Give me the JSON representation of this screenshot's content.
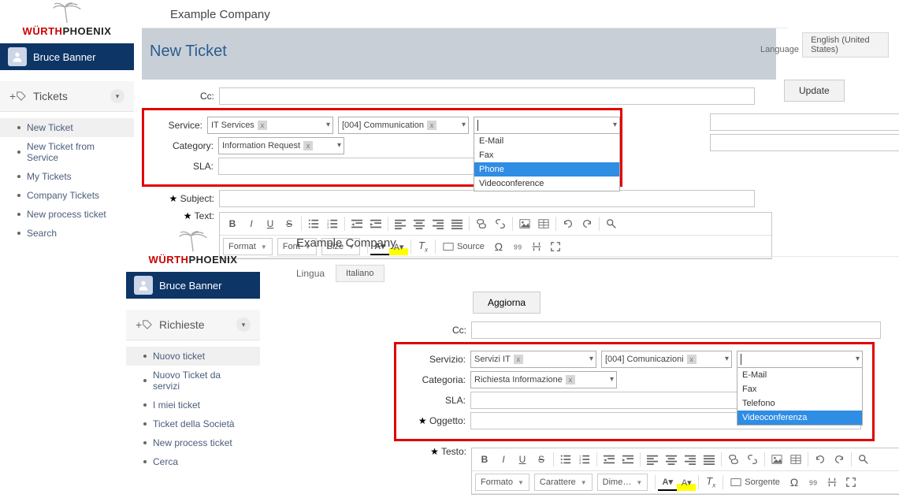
{
  "brand": {
    "part1": "WÜRTH",
    "part2": "PHOENIX"
  },
  "user": {
    "name": "Bruce Banner"
  },
  "en": {
    "company": "Example Company",
    "title": "New Ticket",
    "lang_label": "Language",
    "lang_value": "English (United States)",
    "update": "Update",
    "nav": {
      "section": "Tickets",
      "items": [
        "New Ticket",
        "New Ticket from Service",
        "My Tickets",
        "Company Tickets",
        "New process ticket",
        "Search"
      ]
    },
    "labels": {
      "cc": "Cc:",
      "service": "Service:",
      "category": "Category:",
      "sla": "SLA:",
      "subject": "Subject:",
      "text": "Text:"
    },
    "service_combo1": "IT Services",
    "service_combo2": "[004] Communication",
    "category_combo": "Information Request",
    "dropdown": {
      "options": [
        "E-Mail",
        "Fax",
        "Phone",
        "Videoconference"
      ],
      "selected_index": 2
    },
    "toolbar": {
      "format": "Format",
      "font": "Font",
      "size": "Size",
      "source": "Source"
    }
  },
  "it": {
    "company": "Example Company",
    "lang_label": "Lingua",
    "lang_value": "Italiano",
    "update": "Aggiorna",
    "nav": {
      "section": "Richieste",
      "items": [
        "Nuovo ticket",
        "Nuovo Ticket da servizi",
        "I miei ticket",
        "Ticket della Società",
        "New process ticket",
        "Cerca"
      ]
    },
    "labels": {
      "cc": "Cc:",
      "service": "Servizio:",
      "category": "Categoria:",
      "sla": "SLA:",
      "subject": "Oggetto:",
      "text": "Testo:"
    },
    "service_combo1": "Servizi IT",
    "service_combo2": "[004] Comunicazioni",
    "category_combo": "Richiesta Informazione",
    "dropdown": {
      "options": [
        "E-Mail",
        "Fax",
        "Telefono",
        "Videoconferenza"
      ],
      "selected_index": 3
    },
    "toolbar": {
      "format": "Formato",
      "font": "Carattere",
      "size": "Dime…",
      "source": "Sorgente"
    }
  }
}
